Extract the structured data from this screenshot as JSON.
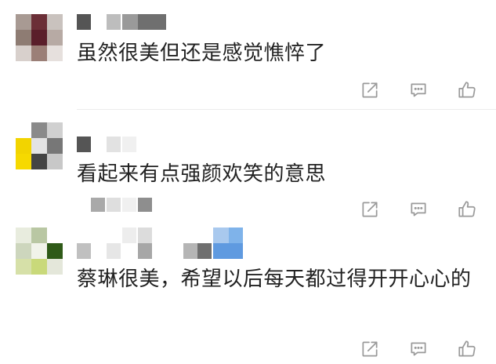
{
  "comments": [
    {
      "text": "虽然很美但还是感觉憔悴了"
    },
    {
      "text": "看起来有点强颜欢笑的意思"
    },
    {
      "text": "蔡琳很美，希望以后每天都过得开开心心的"
    }
  ],
  "icons": {
    "share": "share-icon",
    "reply": "comment-icon",
    "like": "thumbs-up-icon"
  },
  "colors": {
    "icon": "#9a9a9a",
    "text": "#222222",
    "divider": "#ececec"
  }
}
